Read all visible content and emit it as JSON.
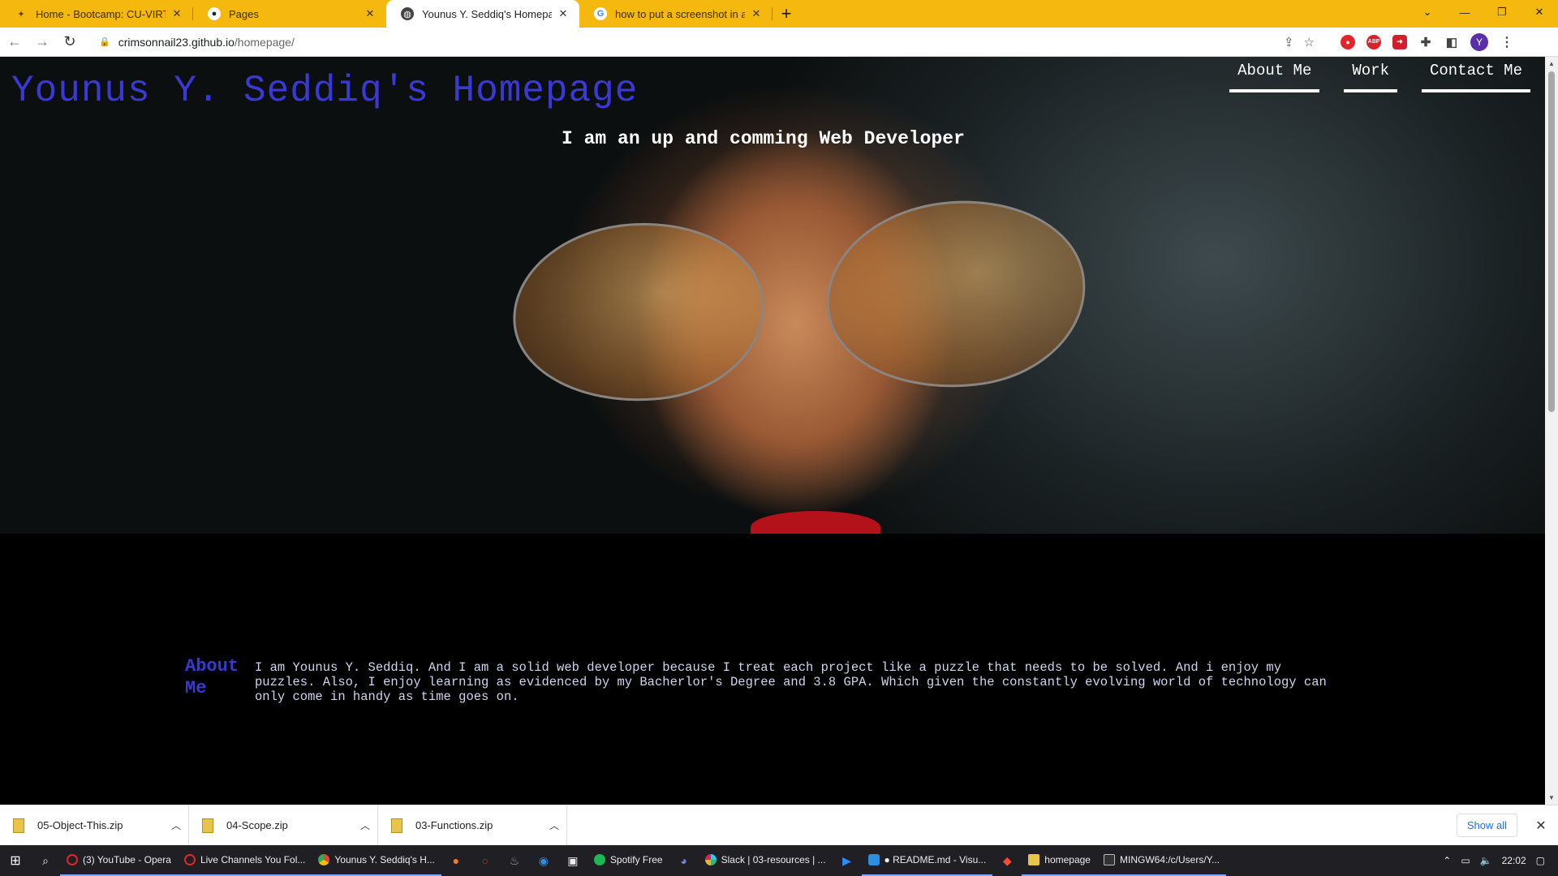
{
  "browser": {
    "tabs": [
      {
        "title": "Home - Bootcamp: CU-VIRT-BO",
        "icon": "canvas-icon",
        "active": false
      },
      {
        "title": "Pages",
        "icon": "github-icon",
        "active": false
      },
      {
        "title": "Younus Y. Seddiq's Homepage",
        "icon": "globe-icon",
        "active": true
      },
      {
        "title": "how to put a screenshot in a rea",
        "icon": "google-icon",
        "active": false
      }
    ],
    "new_tab": "+",
    "url_host": "crimsonnail23.github.io",
    "url_path": "/homepage/",
    "profile_initial": "Y",
    "ext_abp": "ABP"
  },
  "site": {
    "title": "Younus Y. Seddiq's Homepage",
    "tagline": "I am an up and comming Web Developer",
    "nav": [
      "About Me",
      "Work",
      "Contact Me"
    ],
    "about_heading": "About Me",
    "about_text": "I am Younus Y. Seddiq. And I am a solid web developer because I treat each project like a puzzle that needs to be solved. And i enjoy my puzzles. Also, I enjoy learning as evidenced by my Bacherlor's Degree and 3.8 GPA. Which given the constantly evolving world of technology can only come in handy as time goes on.",
    "colors": {
      "title": "#3b39d6",
      "background": "#000000"
    }
  },
  "downloads": {
    "items": [
      "05-Object-This.zip",
      "04-Scope.zip",
      "03-Functions.zip"
    ],
    "show_all": "Show all"
  },
  "taskbar": {
    "apps": [
      {
        "label": "(3) YouTube - Opera",
        "color": "#e0262c"
      },
      {
        "label": "Live Channels You Fol...",
        "color": "#e0262c"
      },
      {
        "label": "Younus Y. Seddiq's H...",
        "color": "#f2b300"
      },
      {
        "label": "Spotify Free",
        "color": "#1db954"
      },
      {
        "label": "Slack | 03-resources | ...",
        "color": "#e0e0e0"
      },
      {
        "label": "● README.md - Visu...",
        "color": "#2b8fe6"
      },
      {
        "label": "homepage",
        "color": "#e8c54a"
      },
      {
        "label": "MINGW64:/c/Users/Y...",
        "color": "#bbbbbb"
      }
    ],
    "clock": "22:02"
  }
}
